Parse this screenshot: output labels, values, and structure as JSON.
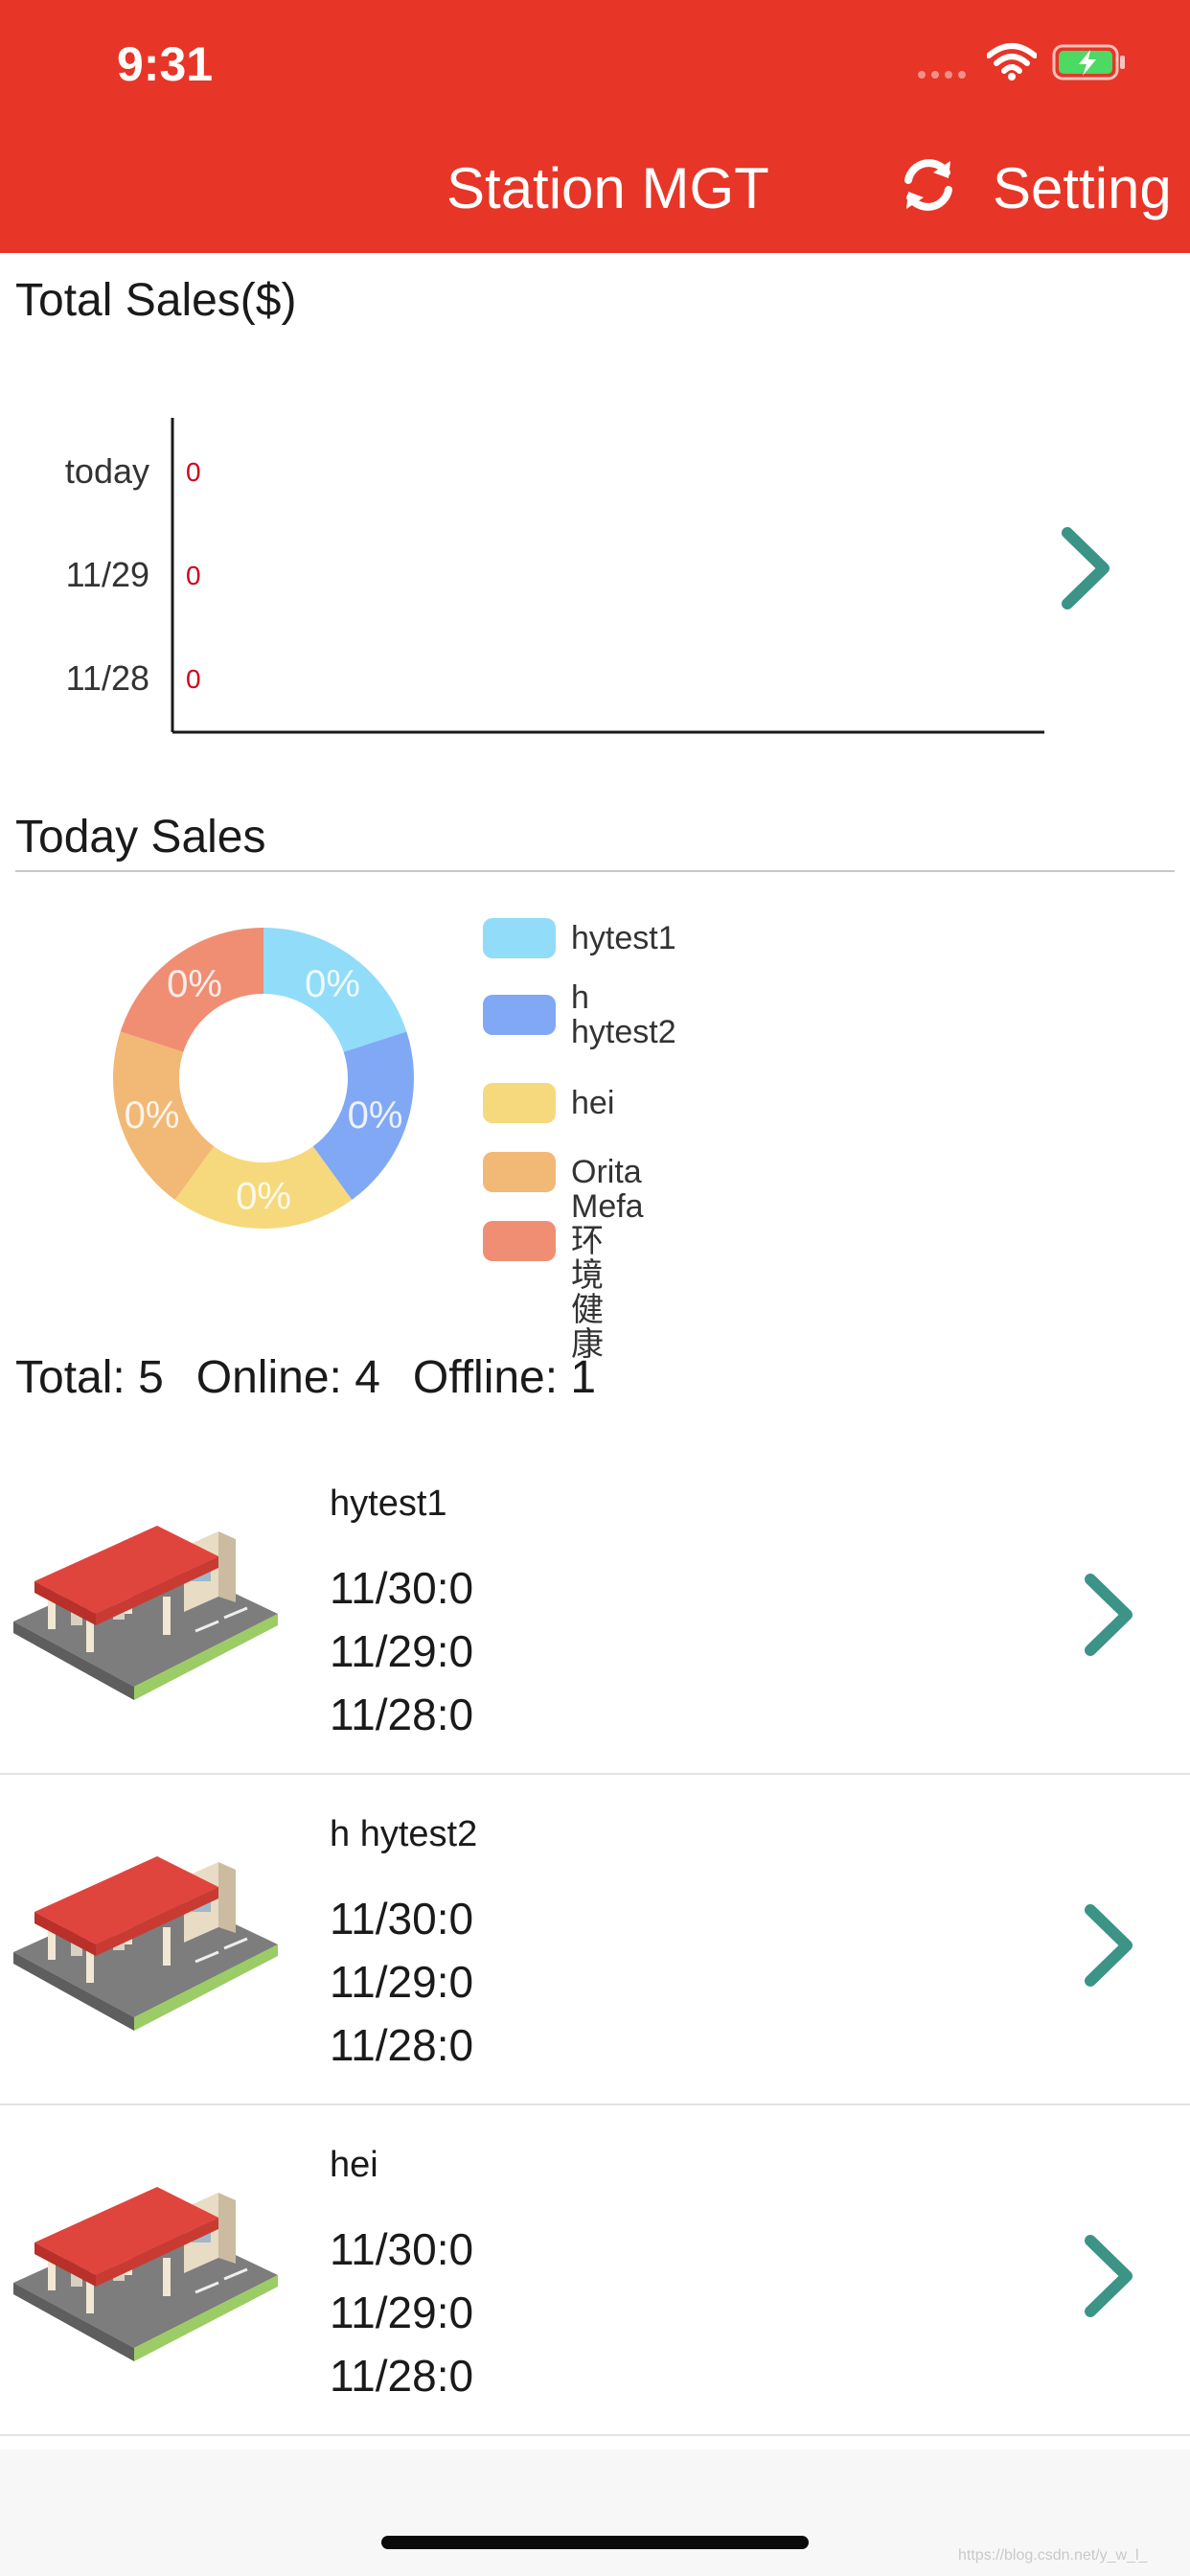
{
  "status_bar": {
    "time": "9:31"
  },
  "header": {
    "title": "Station MGT",
    "setting_label": "Setting",
    "background": "#e73527"
  },
  "total_sales": {
    "title": "Total Sales($)",
    "chart_data": {
      "type": "bar",
      "orientation": "horizontal",
      "categories": [
        "today",
        "11/29",
        "11/28"
      ],
      "values": [
        0,
        0,
        0
      ],
      "data_label_color": "#d0021b"
    }
  },
  "today_sales": {
    "title": "Today Sales",
    "chart_data": {
      "type": "pie",
      "donut": true,
      "categories": [
        "hytest1",
        "h\nhytest2",
        "hei",
        "Orita Mefa",
        "环境健康"
      ],
      "values": [
        20,
        20,
        20,
        20,
        20
      ],
      "slice_labels": [
        "0%",
        "0%",
        "0%",
        "0%",
        "0%"
      ],
      "colors": [
        "#91dcf9",
        "#80a8f5",
        "#f6d97c",
        "#f2b876",
        "#ef8e73"
      ]
    }
  },
  "stats": {
    "total": "Total: 5",
    "online": "Online: 4",
    "offline": "Offline: 1"
  },
  "stations": [
    {
      "name": "hytest1",
      "lines": [
        "11/30:0",
        "11/29:0",
        "11/28:0"
      ]
    },
    {
      "name": "h hytest2",
      "lines": [
        "11/30:0",
        "11/29:0",
        "11/28:0"
      ]
    },
    {
      "name": "hei",
      "lines": [
        "11/30:0",
        "11/29:0",
        "11/28:0"
      ]
    }
  ],
  "watermark": "https://blog.csdn.net/y_w_l_",
  "colors": {
    "accent_arrow": "#3b9486",
    "chart_axis": "#1a1a1a"
  }
}
